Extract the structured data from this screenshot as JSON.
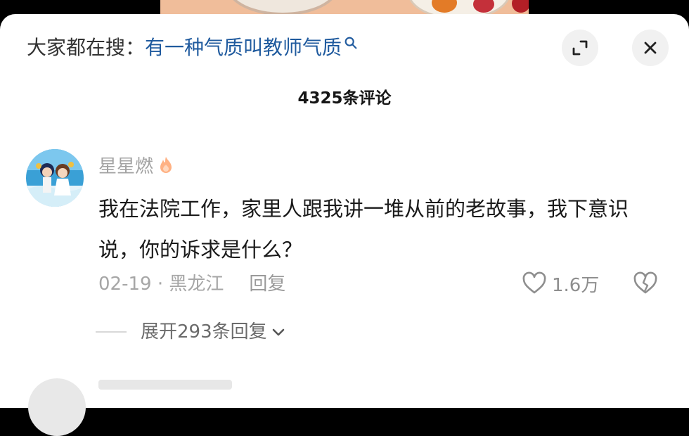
{
  "search": {
    "prefix": "大家都在搜：",
    "term": "有一种气质叫教师气质"
  },
  "comments_header": {
    "count_label": "4325条评论"
  },
  "comment": {
    "username": "星星燃",
    "text": "我在法院工作，家里人跟我讲一堆从前的老故事，我下意识说，你的诉求是什么？",
    "date_location": "02-19 · 黑龙江",
    "reply_label": "回复",
    "likes": "1.6万",
    "expand_replies_label": "展开293条回复"
  },
  "icons": {
    "search": "search-icon",
    "expand": "expand-icon",
    "close": "close-icon",
    "fire": "fire-icon",
    "like": "heart-icon",
    "dislike": "broken-heart-icon",
    "chevron": "chevron-down-icon"
  },
  "colors": {
    "search_term": "#1f5a9e",
    "username": "#a3a3a3",
    "meta": "#a6a6a6"
  }
}
